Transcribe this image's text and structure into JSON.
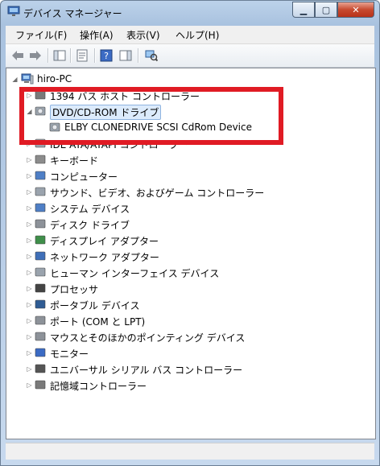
{
  "window": {
    "title": "デバイス マネージャー"
  },
  "menu": [
    "ファイル(F)",
    "操作(A)",
    "表示(V)",
    "ヘルプ(H)"
  ],
  "tree": {
    "root": "hiro-PC",
    "items": [
      {
        "label": "1394 バス ホスト コントローラー",
        "expanded": false
      },
      {
        "label": "DVD/CD-ROM ドライブ",
        "expanded": true,
        "selected": true
      },
      {
        "label": "ELBY CLONEDRIVE SCSI CdRom Device",
        "child": true
      },
      {
        "label": "IDE ATA/ATAPI コントローラー",
        "expanded": false
      },
      {
        "label": "キーボード",
        "expanded": false
      },
      {
        "label": "コンピューター",
        "expanded": false
      },
      {
        "label": "サウンド、ビデオ、およびゲーム コントローラー",
        "expanded": false
      },
      {
        "label": "システム デバイス",
        "expanded": false
      },
      {
        "label": "ディスク ドライブ",
        "expanded": false
      },
      {
        "label": "ディスプレイ アダプター",
        "expanded": false
      },
      {
        "label": "ネットワーク アダプター",
        "expanded": false
      },
      {
        "label": "ヒューマン インターフェイス デバイス",
        "expanded": false
      },
      {
        "label": "プロセッサ",
        "expanded": false
      },
      {
        "label": "ポータブル デバイス",
        "expanded": false
      },
      {
        "label": "ポート (COM と LPT)",
        "expanded": false
      },
      {
        "label": "マウスとそのほかのポインティング デバイス",
        "expanded": false
      },
      {
        "label": "モニター",
        "expanded": false
      },
      {
        "label": "ユニバーサル シリアル バス コントローラー",
        "expanded": false
      },
      {
        "label": "記憶域コントローラー",
        "expanded": false
      }
    ]
  },
  "colors": {
    "annotation": "#e01b24",
    "selection": "#dcebfc"
  }
}
